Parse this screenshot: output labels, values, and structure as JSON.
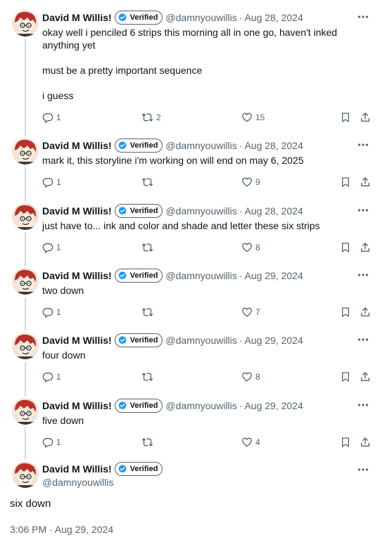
{
  "author": {
    "name": "David M Willis!",
    "verified_label": "Verified",
    "handle": "@damnyouwillis"
  },
  "colors": {
    "verified_blue": "#1d9bf0",
    "muted": "#536471",
    "thread_line": "#cfd9de"
  },
  "tweets": [
    {
      "date": "Aug 28, 2024",
      "lines": [
        "okay well i penciled 6 strips this morning all in one go, haven't inked",
        "anything yet",
        "",
        "must be a pretty important sequence",
        "",
        "i guess"
      ],
      "replies": "1",
      "retweets": "2",
      "likes": "15"
    },
    {
      "date": "Aug 28, 2024",
      "lines": [
        "mark it, this storyline i'm working on will end on may 6, 2025"
      ],
      "replies": "1",
      "retweets": "",
      "likes": "9"
    },
    {
      "date": "Aug 28, 2024",
      "lines": [
        "just have to... ink and color and shade and letter these six strips"
      ],
      "replies": "1",
      "retweets": "",
      "likes": "8"
    },
    {
      "date": "Aug 29, 2024",
      "lines": [
        "two down"
      ],
      "replies": "1",
      "retweets": "",
      "likes": "7"
    },
    {
      "date": "Aug 29, 2024",
      "lines": [
        "four down"
      ],
      "replies": "1",
      "retweets": "",
      "likes": "8"
    },
    {
      "date": "Aug 29, 2024",
      "lines": [
        "five down"
      ],
      "replies": "1",
      "retweets": "",
      "likes": "4"
    }
  ],
  "main_tweet": {
    "text": "six down",
    "timestamp": "3:06 PM · Aug 29, 2024"
  }
}
